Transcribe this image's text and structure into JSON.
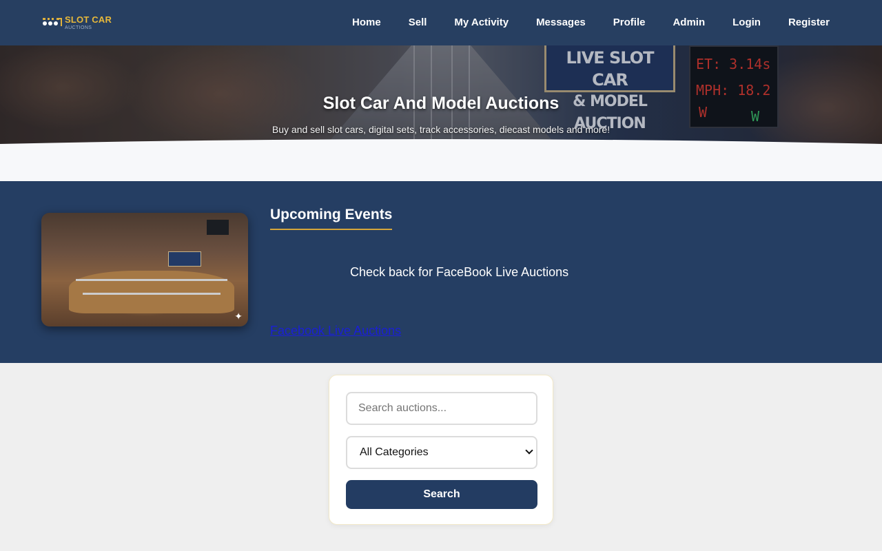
{
  "brand": {
    "name": "SLOT CAR",
    "tagline": "AUCTIONS"
  },
  "nav": {
    "items": [
      {
        "label": "Home"
      },
      {
        "label": "Sell"
      },
      {
        "label": "My Activity"
      },
      {
        "label": "Messages"
      },
      {
        "label": "Profile"
      },
      {
        "label": "Admin"
      },
      {
        "label": "Login"
      },
      {
        "label": "Register"
      }
    ]
  },
  "hero": {
    "title": "Slot Car And Model Auctions",
    "subtitle": "Buy and sell slot cars, digital sets, track accessories, diecast models and more!",
    "sign_line1": "LIVE SLOT CAR",
    "sign_line2": "& MODEL AUCTION",
    "board_et": "ET: 3.14s",
    "board_mph": "MPH: 18.2",
    "board_w": "W"
  },
  "events": {
    "title": "Upcoming Events",
    "note": "Check back for FaceBook Live Auctions",
    "link_label": "Facebook Live Auctions"
  },
  "search": {
    "placeholder": "Search auctions...",
    "category_selected": "All Categories",
    "button_label": "Search"
  },
  "colors": {
    "navbar": "#273f61",
    "events_bg": "#253e63",
    "accent": "#d6a63a",
    "button": "#233c62"
  }
}
